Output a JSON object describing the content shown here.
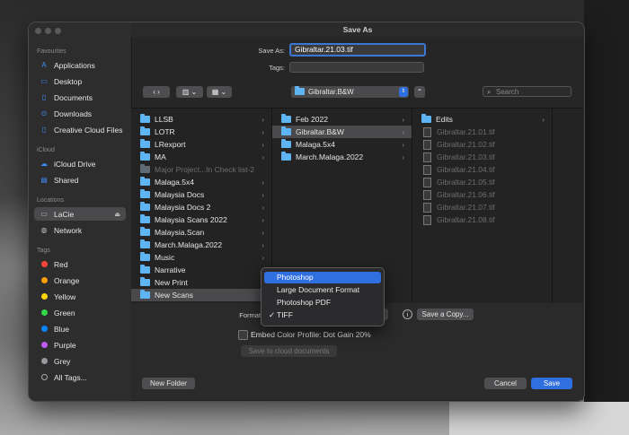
{
  "window": {
    "title": "Save As"
  },
  "sidebar": {
    "favourites_header": "Favourites",
    "favourites": [
      {
        "label": "Applications",
        "icon": "applications-icon"
      },
      {
        "label": "Desktop",
        "icon": "desktop-icon"
      },
      {
        "label": "Documents",
        "icon": "documents-icon"
      },
      {
        "label": "Downloads",
        "icon": "downloads-icon"
      },
      {
        "label": "Creative Cloud Files",
        "icon": "creative-cloud-icon"
      }
    ],
    "icloud_header": "iCloud",
    "icloud": [
      {
        "label": "iCloud Drive",
        "icon": "cloud-icon"
      },
      {
        "label": "Shared",
        "icon": "shared-folder-icon"
      }
    ],
    "locations_header": "Locations",
    "locations": [
      {
        "label": "LaCie",
        "icon": "drive-icon"
      },
      {
        "label": "Network",
        "icon": "globe-icon"
      }
    ],
    "tags_header": "Tags",
    "tags": [
      {
        "label": "Red",
        "color": "#ff453a"
      },
      {
        "label": "Orange",
        "color": "#ff9f0a"
      },
      {
        "label": "Yellow",
        "color": "#ffd60a"
      },
      {
        "label": "Green",
        "color": "#32d74b"
      },
      {
        "label": "Blue",
        "color": "#0a84ff"
      },
      {
        "label": "Purple",
        "color": "#bf5af2"
      },
      {
        "label": "Grey",
        "color": "#98989d"
      },
      {
        "label": "All Tags...",
        "color": ""
      }
    ]
  },
  "save_as": {
    "label": "Save As:",
    "value": "Gibraltar.21.03.tif"
  },
  "tags_field": {
    "label": "Tags:"
  },
  "toolbar": {
    "location": "Gibraltar.B&W",
    "search_placeholder": "Search"
  },
  "columns": {
    "col1": [
      "LLSB",
      "LOTR",
      "LRexport",
      "MA",
      "Major Project...In Check list-2",
      "Malaga.5x4",
      "Malaysia Docs",
      "Malaysia Docs 2",
      "Malaysia Scans 2022",
      "Malaysia.Scan",
      "March.Malaga.2022",
      "Music",
      "Narrative",
      "New Print",
      "New Scans"
    ],
    "col2": [
      "Feb 2022",
      "Gibraltar.B&W",
      "Malaga.5x4",
      "March.Malaga.2022"
    ],
    "col3": [
      "Edits",
      "Gibraltar.21.01.tif",
      "Gibraltar.21.02.tif",
      "Gibraltar.21.03.tif",
      "Gibraltar.21.04.tif",
      "Gibraltar.21.05.tif",
      "Gibraltar.21.06.tif",
      "Gibraltar.21.07.tif",
      "Gibraltar.21.08.tif"
    ]
  },
  "format": {
    "label": "Format",
    "options": [
      "Photoshop",
      "Large Document Format",
      "Photoshop PDF",
      "TIFF"
    ],
    "highlighted": "Photoshop",
    "selected": "TIFF"
  },
  "embed": {
    "label": "Embed Color Profile:",
    "value": "Dot Gain 20%"
  },
  "buttons": {
    "save_copy": "Save a Copy...",
    "cloud": "Save to cloud documents",
    "new_folder": "New Folder",
    "cancel": "Cancel",
    "save": "Save"
  }
}
